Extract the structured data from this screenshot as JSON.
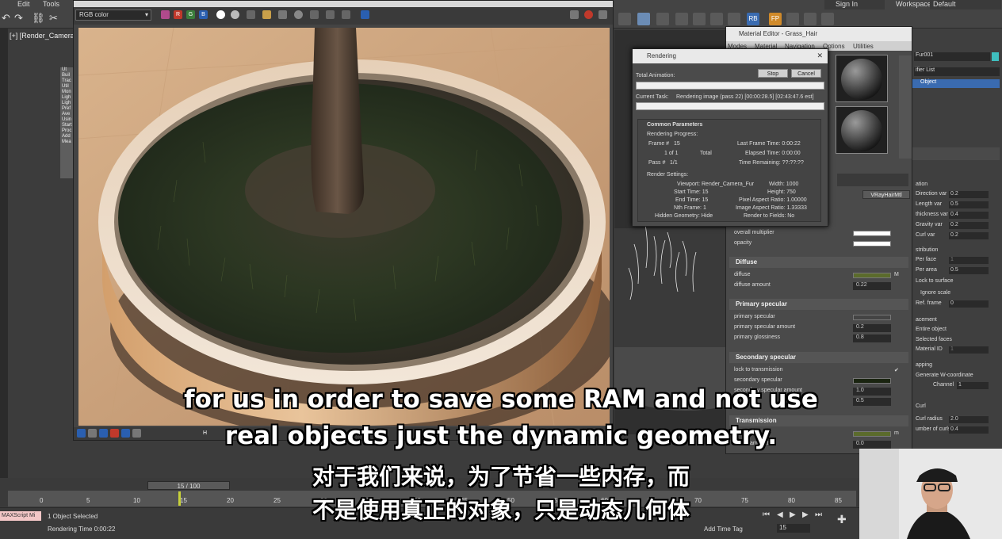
{
  "menubar": {
    "edit": "Edit",
    "tools": "Tools",
    "sign_in": "Sign In",
    "workspaces_label": "Workspaces:",
    "workspace_value": "Default"
  },
  "viewport": {
    "label": "[+] [Render_Camera_F"
  },
  "render_frame": {
    "channel_select": "RGB color",
    "bottom_strip": "H"
  },
  "command_panel": {
    "items": [
      "Ut",
      "Buil",
      "Trac",
      "Util",
      "Mon",
      "Ligh",
      "Ligh",
      "Pref",
      "Ave",
      "Usin",
      "Start",
      "Proc",
      "Add",
      "Mea"
    ]
  },
  "rendering_dialog": {
    "title": "Rendering",
    "total_animation_label": "Total Animation:",
    "stop_button": "Stop",
    "cancel_button": "Cancel",
    "current_task_label": "Current Task:",
    "current_task_value": "Rendering image (pass 22) [00:00:28.5] [02:43:47.6 est]",
    "common_params_title": "Common Parameters",
    "rendering_progress_label": "Rendering Progress:",
    "frame_label": "Frame #",
    "frame_value": "15",
    "of_label": "1 of 1",
    "total_label": "Total",
    "pass_label": "Pass #",
    "pass_value": "1/1",
    "last_frame_time": "Last Frame Time:  0:00:22",
    "elapsed_time": "Elapsed Time:  0:00:00",
    "time_remaining": "Time Remaining:  ??:??:??",
    "render_settings_label": "Render Settings:",
    "viewport_setting": "Viewport: Render_Camera_Fur",
    "width_setting": "Width: 1000",
    "start_time": "Start Time: 15",
    "height_setting": "Height: 750",
    "end_time": "End Time: 15",
    "pixel_aspect": "Pixel Aspect Ratio: 1.00000",
    "nth_frame": "Nth Frame: 1",
    "image_aspect": "Image Aspect Ratio: 1.33333",
    "hidden_geometry": "Hidden Geometry: Hide",
    "render_to_fields": "Render to Fields: No"
  },
  "material_editor": {
    "title": "Material Editor - Grass_Hair",
    "menu": [
      "Modes",
      "Material",
      "Navigation",
      "Options",
      "Utilities"
    ],
    "material_type": "VRayHairMtl",
    "rows_top": [
      {
        "label": "overall multiplier",
        "type": "swatch",
        "color": "#ffffff"
      },
      {
        "label": "opacity",
        "type": "swatch",
        "color": "#ffffff"
      }
    ],
    "diffuse": {
      "title": "Diffuse",
      "diffuse_label": "diffuse",
      "diffuse_color": "#5b6b2c",
      "map_button": "M",
      "amount_label": "diffuse amount",
      "amount_value": "0.22"
    },
    "primary": {
      "title": "Primary specular",
      "specular_label": "primary specular",
      "amount_label": "primary specular amount",
      "amount_value": "0.2",
      "gloss_label": "primary glossiness",
      "gloss_value": "0.8"
    },
    "secondary": {
      "title": "Secondary specular",
      "lock_label": "lock to transmission",
      "specular_label": "secondary specular",
      "specular_color": "#1a2410",
      "amount_label": "secondary specular amount",
      "amount_value": "1.0",
      "gloss_value": "0.5"
    },
    "transmission": {
      "title": "Transmission",
      "map_button": "m",
      "amount_label": "amount",
      "amount_value": "0.0",
      "color": "#5b6b2c"
    }
  },
  "right_panel": {
    "object_name": "Fur001",
    "modifier_list": "ifier List",
    "object_item": "Object",
    "params": [
      {
        "label": "ation",
        "value": ""
      },
      {
        "label": "Direction var",
        "value": "0.2"
      },
      {
        "label": "Length var",
        "value": "0.5"
      },
      {
        "label": "thickness var",
        "value": "0.4"
      },
      {
        "label": "Gravity var",
        "value": "0.2"
      },
      {
        "label": "Curl var",
        "value": "0.2"
      }
    ],
    "distribution_title": "stribution",
    "per_face": "Per face",
    "per_face_value": "1",
    "per_area": "Per area",
    "per_area_value": "0.5",
    "lock_to_surface": "Lock to surface",
    "ignore_scale": "Ignore scale",
    "ref_frame": "Ref. frame",
    "ref_frame_value": "0",
    "placement_title": "acement",
    "entire_object": "Entire object",
    "selected_faces": "Selected faces",
    "material_id": "Material ID",
    "material_id_value": "1",
    "mapping_title": "apping",
    "generate_w": "Generate W-coordinate",
    "channel_label": "Channel",
    "channel_value": "1",
    "curl_title": "Curl",
    "curl_radius": "Curl radius",
    "curl_radius_value": "2.0",
    "num_curls": "umber of curls",
    "num_curls_value": "0.4"
  },
  "timeline": {
    "slider": "15 / 100",
    "ticks": [
      "0",
      "5",
      "10",
      "15",
      "20",
      "25",
      "30",
      "35",
      "40",
      "45",
      "50",
      "55",
      "60",
      "65",
      "70",
      "75",
      "80",
      "85"
    ],
    "frame_field": "15"
  },
  "status": {
    "maxscript": "MAXScript Mi",
    "selected": "1 Object Selected",
    "render_time": "Rendering Time  0:00:22",
    "add_time_tag": "Add Time Tag"
  },
  "subtitles": {
    "line1": "for us in order to save some RAM and not use",
    "line2": "real objects just the dynamic geometry.",
    "line3": "对于我们来说，为了节省一些内存，而",
    "line4": "不是使用真正的对象，只是动态几何体"
  }
}
